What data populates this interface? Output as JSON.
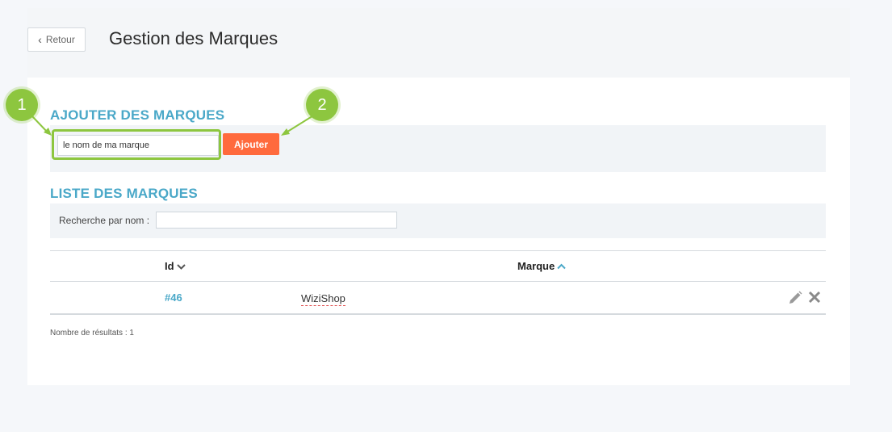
{
  "header": {
    "back_label": "Retour",
    "title": "Gestion des Marques"
  },
  "add_section": {
    "title": "AJOUTER DES MARQUES",
    "input_value": "le nom de ma marque",
    "button_label": "Ajouter"
  },
  "list_section": {
    "title": "LISTE DES MARQUES",
    "search_label": "Recherche par nom :",
    "search_value": ""
  },
  "table": {
    "columns": [
      {
        "label": "Id",
        "sort": "desc"
      },
      {
        "label": "Marque",
        "sort": "asc"
      }
    ],
    "rows": [
      {
        "id": "#46",
        "brand": "WiziShop"
      }
    ]
  },
  "results_text": "Nombre de résultats : 1",
  "annotations": [
    "1",
    "2"
  ],
  "colors": {
    "accent": "#4aa8c8",
    "button": "#ff6a3d",
    "highlight": "#8dc63f"
  }
}
